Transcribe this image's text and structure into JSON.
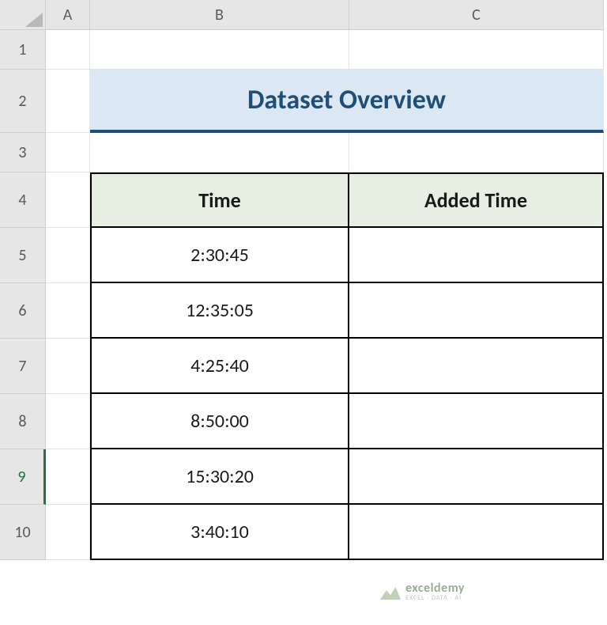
{
  "columns": [
    "A",
    "B",
    "C"
  ],
  "rows": [
    "1",
    "2",
    "3",
    "4",
    "5",
    "6",
    "7",
    "8",
    "9",
    "10"
  ],
  "selected_row": "9",
  "title": "Dataset Overview",
  "table": {
    "headers": {
      "time": "Time",
      "added": "Added Time"
    },
    "data": [
      {
        "time": "2:30:45",
        "added": ""
      },
      {
        "time": "12:35:05",
        "added": ""
      },
      {
        "time": "4:25:40",
        "added": ""
      },
      {
        "time": "8:50:00",
        "added": ""
      },
      {
        "time": "15:30:20",
        "added": ""
      },
      {
        "time": "3:40:10",
        "added": ""
      }
    ]
  },
  "watermark": {
    "name": "exceldemy",
    "tag": "EXCEL · DATA · AI"
  },
  "chart_data": {
    "type": "table",
    "title": "Dataset Overview",
    "columns": [
      "Time",
      "Added Time"
    ],
    "rows": [
      [
        "2:30:45",
        ""
      ],
      [
        "12:35:05",
        ""
      ],
      [
        "4:25:40",
        ""
      ],
      [
        "8:50:00",
        ""
      ],
      [
        "15:30:20",
        ""
      ],
      [
        "3:40:10",
        ""
      ]
    ]
  }
}
